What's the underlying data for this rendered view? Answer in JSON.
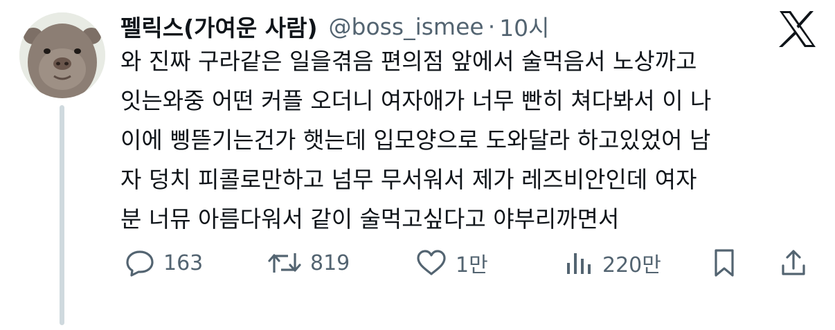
{
  "author": {
    "display_name": "펠릭스(가여운 사람)",
    "handle": "@boss_ismee",
    "separator": "·",
    "time": "10시",
    "avatar_icon": "rodent-avatar"
  },
  "brand": {
    "icon": "x-logo-icon"
  },
  "post": {
    "lines": [
      "와 진짜 구라같은 일을겪음 편의점 앞에서 술먹음서 노상까고",
      "잇는와중 어떤 커플 오더니 여자애가 너무 빤히 쳐다봐서 이 나",
      "이에 삥뜯기는건가 햇는데 입모양으로 도와달라 하고있었어 남",
      "자 덩치 피콜로만하고 넘무 무서워서 제가 레즈비안인데 여자",
      "분 너뮤 아름다워서 같이 술먹고싶다고 야부리까면서"
    ]
  },
  "actions": {
    "reply_count": "163",
    "repost_count": "819",
    "like_count": "1만",
    "view_count": "220만"
  },
  "colors": {
    "text": "#0f1419",
    "secondary": "#536471",
    "thread_line": "#cfd9de"
  }
}
